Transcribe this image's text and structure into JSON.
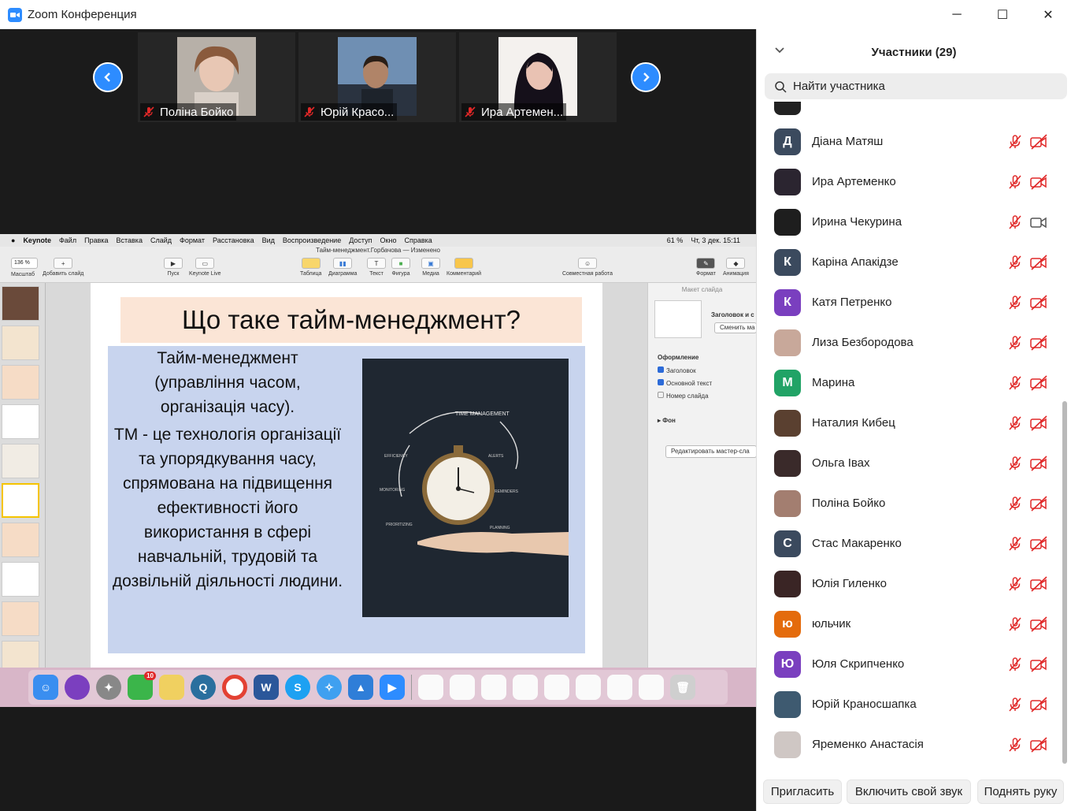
{
  "window": {
    "title": "Zoom Конференция",
    "controls": {
      "minimize": "─",
      "maximize": "☐",
      "close": "✕"
    }
  },
  "video_strip": {
    "tiles": [
      {
        "name": "Поліна Бойко",
        "muted": true
      },
      {
        "name": "Юрій Красо...",
        "muted": true
      },
      {
        "name": "Ира Артемен...",
        "muted": true
      }
    ]
  },
  "shared_screen": {
    "menubar": {
      "items": [
        "Keynote",
        "Файл",
        "Правка",
        "Вставка",
        "Слайд",
        "Формат",
        "Расстановка",
        "Вид",
        "Воспроизведение",
        "Доступ",
        "Окно",
        "Справка"
      ],
      "battery": "61 %",
      "datetime": "Чт, 3 дек.  15:11"
    },
    "doc_title": "Тайм-менеджмент.Горбачова — Изменено",
    "toolbar": {
      "zoom": "136 %",
      "items": [
        "Масштаб",
        "Добавить слайд",
        "Пуск",
        "Keynote Live",
        "Таблица",
        "Диаграмма",
        "Текст",
        "Фигура",
        "Медиа",
        "Комментарий",
        "Совместная работа",
        "Формат",
        "Анимация"
      ]
    },
    "slide": {
      "title": "Що таке тайм-менеджмент?",
      "para1": "Тайм-менеджмент (управління часом, організація часу).",
      "para2": "ТМ - це технологія організації та упорядкування часу, спрямована на підвищення ефективності його використання в сфері навчальній, трудовій та дозвільній діяльності людини.",
      "image_caption": "TIME MANAGEMENT",
      "image_labels": [
        "EFFICIENCY",
        "ALERTS",
        "MONITORING",
        "REMINDERS",
        "PRIORITIZING",
        "PLANNING"
      ]
    },
    "inspector": {
      "header": "Макет слайда",
      "layout_name": "Заголовок и с",
      "change_master": "Сменить ма",
      "section": "Оформление",
      "checkboxes": [
        {
          "label": "Заголовок",
          "checked": true
        },
        {
          "label": "Основной текст",
          "checked": true
        },
        {
          "label": "Номер слайда",
          "checked": false
        }
      ],
      "background": "Фон",
      "edit_master": "Редактировать мастер-сла"
    },
    "dock_badge": "10"
  },
  "participants_panel": {
    "title": "Участники (29)",
    "search_placeholder": "Найти участника",
    "participants": [
      {
        "name": "Діана Матяш",
        "initial": "Д",
        "avatar_color": "#3b4a5e",
        "camera_on": false
      },
      {
        "name": "Ира Артеменко",
        "initial": "",
        "avatar_color": "#2b2530",
        "camera_on": false
      },
      {
        "name": "Ирина Чекурина",
        "initial": "",
        "avatar_color": "#1e1e1e",
        "camera_on": true
      },
      {
        "name": "Каріна Апакідзе",
        "initial": "К",
        "avatar_color": "#3b4a5e",
        "camera_on": false
      },
      {
        "name": "Катя Петренко",
        "initial": "К",
        "avatar_color": "#7a3fbf",
        "camera_on": false
      },
      {
        "name": "Лиза Безбородова",
        "initial": "",
        "avatar_color": "#c8a89a",
        "camera_on": false
      },
      {
        "name": "Марина",
        "initial": "М",
        "avatar_color": "#21a366",
        "camera_on": false
      },
      {
        "name": "Наталия Кибец",
        "initial": "",
        "avatar_color": "#5a4030",
        "camera_on": false
      },
      {
        "name": "Ольга Івах",
        "initial": "",
        "avatar_color": "#3a2a2a",
        "camera_on": false
      },
      {
        "name": "Поліна Бойко",
        "initial": "",
        "avatar_color": "#a37e70",
        "camera_on": false
      },
      {
        "name": "Стас Макаренко",
        "initial": "С",
        "avatar_color": "#3b4a5e",
        "camera_on": false
      },
      {
        "name": "Юлія Гиленко",
        "initial": "",
        "avatar_color": "#3a2525",
        "camera_on": false
      },
      {
        "name": "юльчик",
        "initial": "ю",
        "avatar_color": "#e46b0c",
        "camera_on": false
      },
      {
        "name": "Юля Скрипченко",
        "initial": "Ю",
        "avatar_color": "#7a3fbf",
        "camera_on": false
      },
      {
        "name": "Юрій Краносшапка",
        "initial": "",
        "avatar_color": "#3e5a70",
        "camera_on": false
      },
      {
        "name": "Яременко Анастасія",
        "initial": "",
        "avatar_color": "#cfc7c4",
        "camera_on": false
      }
    ],
    "footer": {
      "invite": "Пригласить",
      "unmute": "Включить свой звук",
      "raise_hand": "Поднять руку"
    }
  },
  "colors": {
    "accent": "#2d8cff",
    "muted_red": "#e02828"
  }
}
